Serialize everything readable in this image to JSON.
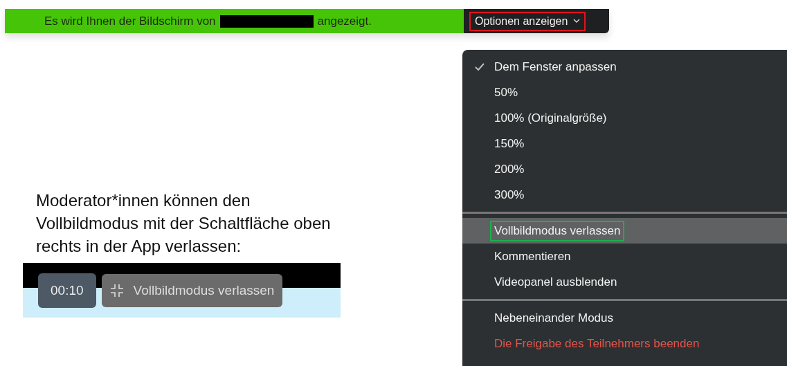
{
  "banner": {
    "text_before": "Es wird Ihnen der Bildschirm von",
    "redacted": true,
    "text_after": "angezeigt."
  },
  "options_button": {
    "label": "Optionen anzeigen",
    "annotated": true
  },
  "explanation": "Moderator*innen können den Vollbildmodus mit der Schaltfläche oben rechts in der App verlassen:",
  "app_toolbar": {
    "timer": "00:10",
    "exit_button": "Vollbildmodus verlassen"
  },
  "menu": {
    "groups": [
      {
        "items": [
          {
            "label": "Dem Fenster anpassen",
            "checked": true,
            "selected": false,
            "annotated": false,
            "kind": "normal"
          },
          {
            "label": "50%",
            "checked": false,
            "selected": false,
            "annotated": false,
            "kind": "normal"
          },
          {
            "label": "100% (Originalgröße)",
            "checked": false,
            "selected": false,
            "annotated": false,
            "kind": "normal"
          },
          {
            "label": "150%",
            "checked": false,
            "selected": false,
            "annotated": false,
            "kind": "normal"
          },
          {
            "label": "200%",
            "checked": false,
            "selected": false,
            "annotated": false,
            "kind": "normal"
          },
          {
            "label": "300%",
            "checked": false,
            "selected": false,
            "annotated": false,
            "kind": "normal"
          }
        ]
      },
      {
        "items": [
          {
            "label": "Vollbildmodus verlassen",
            "checked": false,
            "selected": true,
            "annotated": true,
            "kind": "normal"
          },
          {
            "label": "Kommentieren",
            "checked": false,
            "selected": false,
            "annotated": false,
            "kind": "normal"
          },
          {
            "label": "Videopanel ausblenden",
            "checked": false,
            "selected": false,
            "annotated": false,
            "kind": "normal"
          }
        ]
      },
      {
        "items": [
          {
            "label": "Nebeneinander Modus",
            "checked": false,
            "selected": false,
            "annotated": false,
            "kind": "normal"
          },
          {
            "label": "Die Freigabe des Teilnehmers beenden",
            "checked": false,
            "selected": false,
            "annotated": false,
            "kind": "danger"
          }
        ]
      }
    ]
  }
}
